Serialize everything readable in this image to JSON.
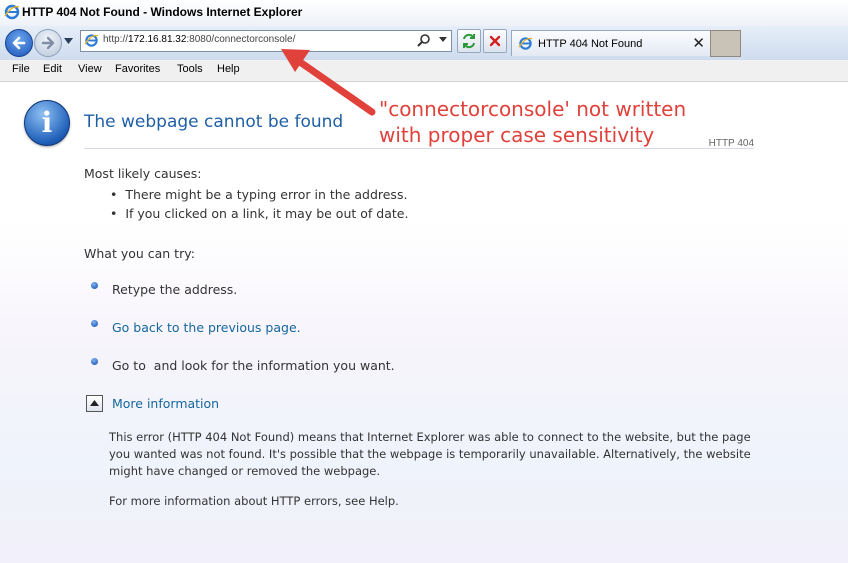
{
  "window": {
    "title": "HTTP 404 Not Found - Windows Internet Explorer"
  },
  "toolbar": {
    "url_prefix": "http://",
    "url_host": "172.16.81.32",
    "url_rest": ":8080/connectorconsole/",
    "tab_label": "HTTP 404 Not Found",
    "tab_close": "✕"
  },
  "menubar": {
    "items": [
      "File",
      "Edit",
      "View",
      "Favorites",
      "Tools",
      "Help"
    ]
  },
  "page": {
    "heading": "The webpage cannot be found",
    "http_code": "HTTP 404",
    "causes_title": "Most likely causes:",
    "causes": [
      "There might be a typing error in the address.",
      "If you clicked on a link, it may be out of date."
    ],
    "try_title": "What you can try:",
    "try_items": [
      "Retype the address.",
      "Go back to the previous page.",
      "Go to  and look for the information you want."
    ],
    "more_info_label": "More information",
    "more_info_text": "This error (HTTP 404 Not Found) means that Internet Explorer was able to connect to the website, but the page you wanted was not found. It's possible that the webpage is temporarily unavailable. Alternatively, the website might have changed or removed the webpage.",
    "help_text": "For more information about HTTP errors, see Help."
  },
  "annotation": {
    "line1": "\"connectorconsole' not written",
    "line2": "with proper case sensitivity",
    "color": "#e0413a"
  },
  "icons": {
    "app": "ie-logo-icon",
    "back": "back-arrow-icon",
    "forward": "forward-arrow-icon",
    "refresh": "refresh-icon",
    "stop": "stop-icon",
    "search": "search-icon",
    "info": "info-icon",
    "collapse": "chevron-up-icon"
  }
}
